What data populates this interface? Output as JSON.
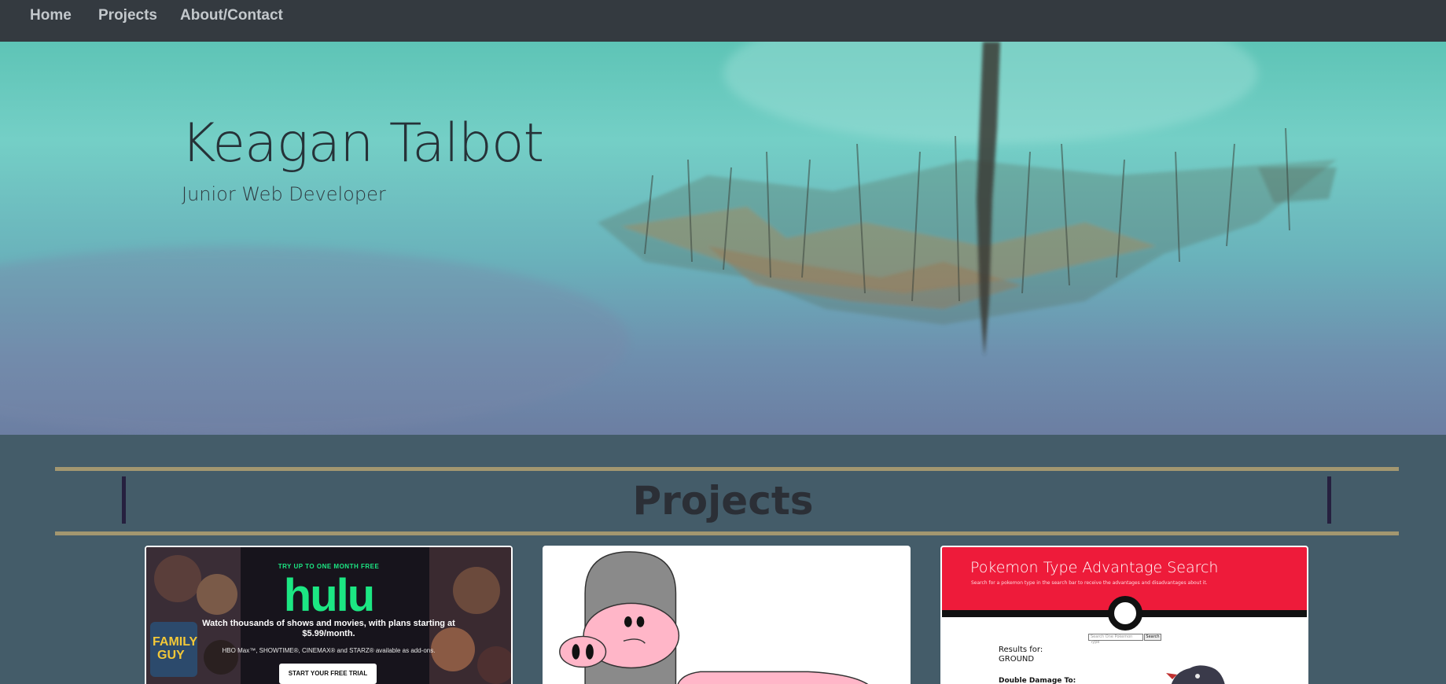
{
  "nav": {
    "items": [
      {
        "label": "Home"
      },
      {
        "label": "Projects"
      },
      {
        "label": "About/Contact"
      }
    ]
  },
  "hero": {
    "title": "Keagan Talbot",
    "subtitle": "Junior Web Developer"
  },
  "projects": {
    "heading": "Projects",
    "cards": [
      {
        "name": "hulu",
        "small": "TRY UP TO ONE MONTH FREE",
        "logo": "hulu",
        "line": "Watch thousands of shows and movies, with plans starting at $5.99/month.",
        "addons": "HBO Max™, SHOWTIME®, CINEMAX® and STARZ® available as add-ons.",
        "button": "START YOUR FREE TRIAL"
      },
      {
        "name": "pig"
      },
      {
        "name": "pokemon",
        "title": "Pokemon Type Advantage Search",
        "desc": "Search for a pokemon type in the search bar to receive the advantages and disadvantages about it.",
        "placeholder": "Search One Pokemon Type",
        "search": "Search",
        "results_label": "Results for:",
        "results_value": "GROUND",
        "double_label": "Double Damage To:"
      }
    ]
  },
  "colors": {
    "nav": "#343a40",
    "page": "#445c69",
    "rule": "#a39770",
    "pokemon_red": "#ee1b3a",
    "hulu_green": "#1ce783"
  }
}
